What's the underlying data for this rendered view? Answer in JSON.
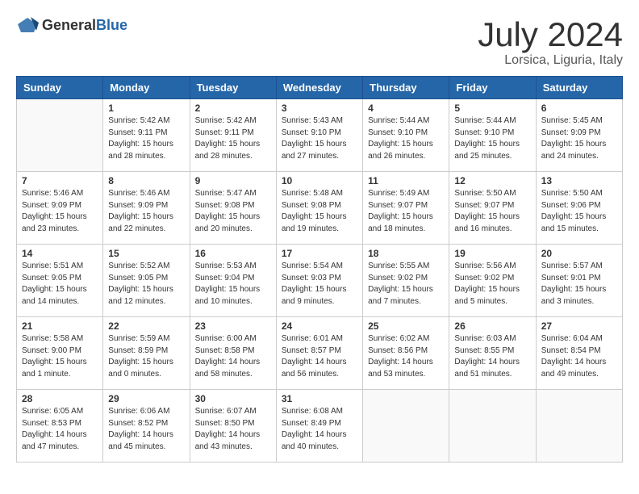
{
  "header": {
    "logo": {
      "general": "General",
      "blue": "Blue"
    },
    "title": "July 2024",
    "location": "Lorsica, Liguria, Italy"
  },
  "weekdays": [
    "Sunday",
    "Monday",
    "Tuesday",
    "Wednesday",
    "Thursday",
    "Friday",
    "Saturday"
  ],
  "weeks": [
    [
      {
        "day": "",
        "info": ""
      },
      {
        "day": "1",
        "info": "Sunrise: 5:42 AM\nSunset: 9:11 PM\nDaylight: 15 hours\nand 28 minutes."
      },
      {
        "day": "2",
        "info": "Sunrise: 5:42 AM\nSunset: 9:11 PM\nDaylight: 15 hours\nand 28 minutes."
      },
      {
        "day": "3",
        "info": "Sunrise: 5:43 AM\nSunset: 9:10 PM\nDaylight: 15 hours\nand 27 minutes."
      },
      {
        "day": "4",
        "info": "Sunrise: 5:44 AM\nSunset: 9:10 PM\nDaylight: 15 hours\nand 26 minutes."
      },
      {
        "day": "5",
        "info": "Sunrise: 5:44 AM\nSunset: 9:10 PM\nDaylight: 15 hours\nand 25 minutes."
      },
      {
        "day": "6",
        "info": "Sunrise: 5:45 AM\nSunset: 9:09 PM\nDaylight: 15 hours\nand 24 minutes."
      }
    ],
    [
      {
        "day": "7",
        "info": "Sunrise: 5:46 AM\nSunset: 9:09 PM\nDaylight: 15 hours\nand 23 minutes."
      },
      {
        "day": "8",
        "info": "Sunrise: 5:46 AM\nSunset: 9:09 PM\nDaylight: 15 hours\nand 22 minutes."
      },
      {
        "day": "9",
        "info": "Sunrise: 5:47 AM\nSunset: 9:08 PM\nDaylight: 15 hours\nand 20 minutes."
      },
      {
        "day": "10",
        "info": "Sunrise: 5:48 AM\nSunset: 9:08 PM\nDaylight: 15 hours\nand 19 minutes."
      },
      {
        "day": "11",
        "info": "Sunrise: 5:49 AM\nSunset: 9:07 PM\nDaylight: 15 hours\nand 18 minutes."
      },
      {
        "day": "12",
        "info": "Sunrise: 5:50 AM\nSunset: 9:07 PM\nDaylight: 15 hours\nand 16 minutes."
      },
      {
        "day": "13",
        "info": "Sunrise: 5:50 AM\nSunset: 9:06 PM\nDaylight: 15 hours\nand 15 minutes."
      }
    ],
    [
      {
        "day": "14",
        "info": "Sunrise: 5:51 AM\nSunset: 9:05 PM\nDaylight: 15 hours\nand 14 minutes."
      },
      {
        "day": "15",
        "info": "Sunrise: 5:52 AM\nSunset: 9:05 PM\nDaylight: 15 hours\nand 12 minutes."
      },
      {
        "day": "16",
        "info": "Sunrise: 5:53 AM\nSunset: 9:04 PM\nDaylight: 15 hours\nand 10 minutes."
      },
      {
        "day": "17",
        "info": "Sunrise: 5:54 AM\nSunset: 9:03 PM\nDaylight: 15 hours\nand 9 minutes."
      },
      {
        "day": "18",
        "info": "Sunrise: 5:55 AM\nSunset: 9:02 PM\nDaylight: 15 hours\nand 7 minutes."
      },
      {
        "day": "19",
        "info": "Sunrise: 5:56 AM\nSunset: 9:02 PM\nDaylight: 15 hours\nand 5 minutes."
      },
      {
        "day": "20",
        "info": "Sunrise: 5:57 AM\nSunset: 9:01 PM\nDaylight: 15 hours\nand 3 minutes."
      }
    ],
    [
      {
        "day": "21",
        "info": "Sunrise: 5:58 AM\nSunset: 9:00 PM\nDaylight: 15 hours\nand 1 minute."
      },
      {
        "day": "22",
        "info": "Sunrise: 5:59 AM\nSunset: 8:59 PM\nDaylight: 15 hours\nand 0 minutes."
      },
      {
        "day": "23",
        "info": "Sunrise: 6:00 AM\nSunset: 8:58 PM\nDaylight: 14 hours\nand 58 minutes."
      },
      {
        "day": "24",
        "info": "Sunrise: 6:01 AM\nSunset: 8:57 PM\nDaylight: 14 hours\nand 56 minutes."
      },
      {
        "day": "25",
        "info": "Sunrise: 6:02 AM\nSunset: 8:56 PM\nDaylight: 14 hours\nand 53 minutes."
      },
      {
        "day": "26",
        "info": "Sunrise: 6:03 AM\nSunset: 8:55 PM\nDaylight: 14 hours\nand 51 minutes."
      },
      {
        "day": "27",
        "info": "Sunrise: 6:04 AM\nSunset: 8:54 PM\nDaylight: 14 hours\nand 49 minutes."
      }
    ],
    [
      {
        "day": "28",
        "info": "Sunrise: 6:05 AM\nSunset: 8:53 PM\nDaylight: 14 hours\nand 47 minutes."
      },
      {
        "day": "29",
        "info": "Sunrise: 6:06 AM\nSunset: 8:52 PM\nDaylight: 14 hours\nand 45 minutes."
      },
      {
        "day": "30",
        "info": "Sunrise: 6:07 AM\nSunset: 8:50 PM\nDaylight: 14 hours\nand 43 minutes."
      },
      {
        "day": "31",
        "info": "Sunrise: 6:08 AM\nSunset: 8:49 PM\nDaylight: 14 hours\nand 40 minutes."
      },
      {
        "day": "",
        "info": ""
      },
      {
        "day": "",
        "info": ""
      },
      {
        "day": "",
        "info": ""
      }
    ]
  ]
}
